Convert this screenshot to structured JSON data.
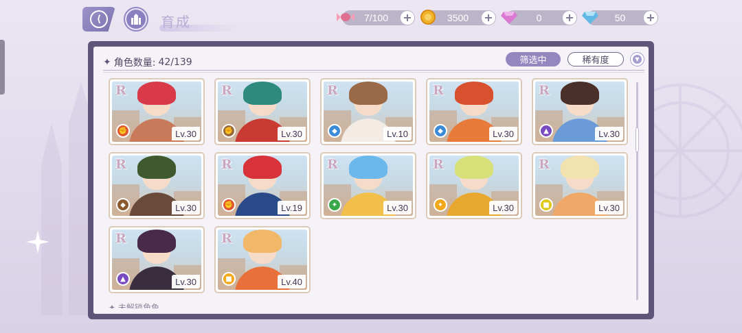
{
  "header": {
    "title": "育成",
    "back_icon": "back-arrow-icon",
    "home_icon": "castle-home-icon"
  },
  "currencies": [
    {
      "name": "stamina",
      "icon": "candy-icon",
      "value": "7/100",
      "color": "#e07090"
    },
    {
      "name": "gold",
      "icon": "gold-coin-icon",
      "value": "3500",
      "color": "#f2b12a"
    },
    {
      "name": "pink-gem",
      "icon": "pink-diamond-icon",
      "value": "0",
      "color": "#d97ad0"
    },
    {
      "name": "blue-gem",
      "icon": "blue-diamond-icon",
      "value": "50",
      "color": "#62b9e6"
    }
  ],
  "panel": {
    "count_label": "角色数量:",
    "count_value": "42/139",
    "filter_label": "筛选中",
    "rarity_label": "稀有度",
    "locked_label": "未解锁角色"
  },
  "cards": [
    {
      "rarity": "R",
      "level": "Lv.30",
      "class_color": "#e0562e",
      "class_icon": "fist-icon",
      "hair": "#d83a4a",
      "outfit": "#c87a5a"
    },
    {
      "rarity": "R",
      "level": "Lv.30",
      "class_color": "#9a6a3a",
      "class_icon": "fist-icon",
      "hair": "#2e8a7e",
      "outfit": "#c83a32"
    },
    {
      "rarity": "R",
      "level": "Lv.10",
      "class_color": "#3a8ad8",
      "class_icon": "shield-icon",
      "hair": "#9a6a48",
      "outfit": "#f4ece4"
    },
    {
      "rarity": "R",
      "level": "Lv.30",
      "class_color": "#3a8ad8",
      "class_icon": "shield-icon",
      "hair": "#d8502e",
      "outfit": "#e87a3a"
    },
    {
      "rarity": "R",
      "level": "Lv.30",
      "class_color": "#7a4ac0",
      "class_icon": "boot-icon",
      "hair": "#4a3028",
      "outfit": "#6a9ad8"
    },
    {
      "rarity": "R",
      "level": "Lv.30",
      "class_color": "#8a5a2e",
      "class_icon": "shield-icon",
      "hair": "#3e5a2e",
      "outfit": "#6a4a3a"
    },
    {
      "rarity": "R",
      "level": "Lv.19",
      "class_color": "#e0562e",
      "class_icon": "fist-icon",
      "hair": "#d8323a",
      "outfit": "#2a4a8a"
    },
    {
      "rarity": "R",
      "level": "Lv.30",
      "class_color": "#3aa84a",
      "class_icon": "wand-icon",
      "hair": "#6ab8ec",
      "outfit": "#f2c04a"
    },
    {
      "rarity": "R",
      "level": "Lv.30",
      "class_color": "#f2a81a",
      "class_icon": "wand-icon",
      "hair": "#d8e07a",
      "outfit": "#e8a830"
    },
    {
      "rarity": "R",
      "level": "Lv.30",
      "class_color": "#e0c81a",
      "class_icon": "book-icon",
      "hair": "#f2e2b0",
      "outfit": "#f0a868"
    },
    {
      "rarity": "R",
      "level": "Lv.30",
      "class_color": "#7a4ac0",
      "class_icon": "boot-icon",
      "hair": "#4a2a4a",
      "outfit": "#3a2e3e"
    },
    {
      "rarity": "R",
      "level": "Lv.40",
      "class_color": "#f2a81a",
      "class_icon": "book-icon",
      "hair": "#f2b86a",
      "outfit": "#e8703a"
    }
  ]
}
